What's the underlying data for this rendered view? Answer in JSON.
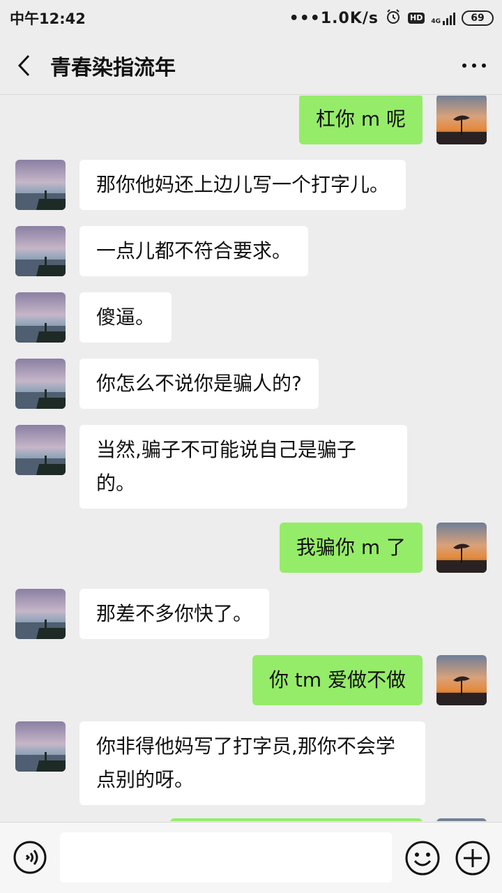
{
  "status_bar": {
    "time": "中午12:42",
    "net_speed": "•••1.0K/s",
    "hd": "HD",
    "network": "4G",
    "battery": "69"
  },
  "nav": {
    "title": "青春染指流年",
    "back_icon": "chevron-left-icon",
    "more_icon": "more-dots-icon"
  },
  "messages": [
    {
      "side": "out",
      "text": "杠你 m 呢"
    },
    {
      "side": "in",
      "text": "那你他妈还上边儿写一个打字儿。"
    },
    {
      "side": "in",
      "text": "一点儿都不符合要求。"
    },
    {
      "side": "in",
      "text": "傻逼。"
    },
    {
      "side": "in",
      "text": "你怎么不说你是骗人的?"
    },
    {
      "side": "in",
      "text": "当然,骗子不可能说自己是骗子的。"
    },
    {
      "side": "out",
      "text": "我骗你 m 了"
    },
    {
      "side": "in",
      "text": "那差不多你快了。"
    },
    {
      "side": "out",
      "text": "你 tm 爱做不做"
    },
    {
      "side": "in",
      "text": "你非得他妈写了打字员,那你不会学点别的呀。"
    },
    {
      "side": "out",
      "text": ""
    }
  ],
  "bottom_bar": {
    "voice_icon": "voice-icon",
    "input_value": "",
    "emoji_icon": "emoji-icon",
    "plus_icon": "plus-icon"
  },
  "colors": {
    "background": "#ededed",
    "incoming_bubble": "#ffffff",
    "outgoing_bubble": "#95ec69"
  }
}
